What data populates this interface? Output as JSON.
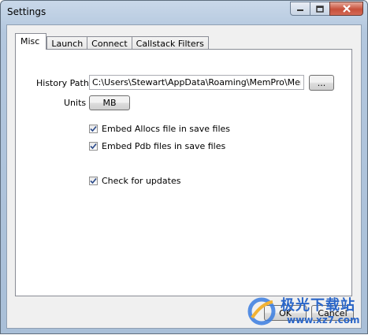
{
  "window": {
    "title": "Settings",
    "minimize_icon": "minimize-icon",
    "maximize_icon": "maximize-icon",
    "close_icon": "close-icon"
  },
  "tabs": [
    {
      "label": "Misc",
      "active": true
    },
    {
      "label": "Launch",
      "active": false
    },
    {
      "label": "Connect",
      "active": false
    },
    {
      "label": "Callstack Filters",
      "active": false
    }
  ],
  "misc": {
    "history_path_label": "History Path",
    "history_path_value": "C:\\Users\\Stewart\\AppData\\Roaming\\MemPro\\MemPro.",
    "browse_label": "...",
    "units_label": "Units",
    "units_value": "MB",
    "checkboxes": [
      {
        "label": "Embed Allocs file in save files",
        "checked": true
      },
      {
        "label": "Embed Pdb files in save files",
        "checked": true
      },
      {
        "label": "Check for updates",
        "checked": true
      }
    ]
  },
  "footer": {
    "ok_label": "OK",
    "cancel_label": "Cancel"
  },
  "watermark": {
    "line1": "极光下载站",
    "line2": "www.xz7.com"
  }
}
